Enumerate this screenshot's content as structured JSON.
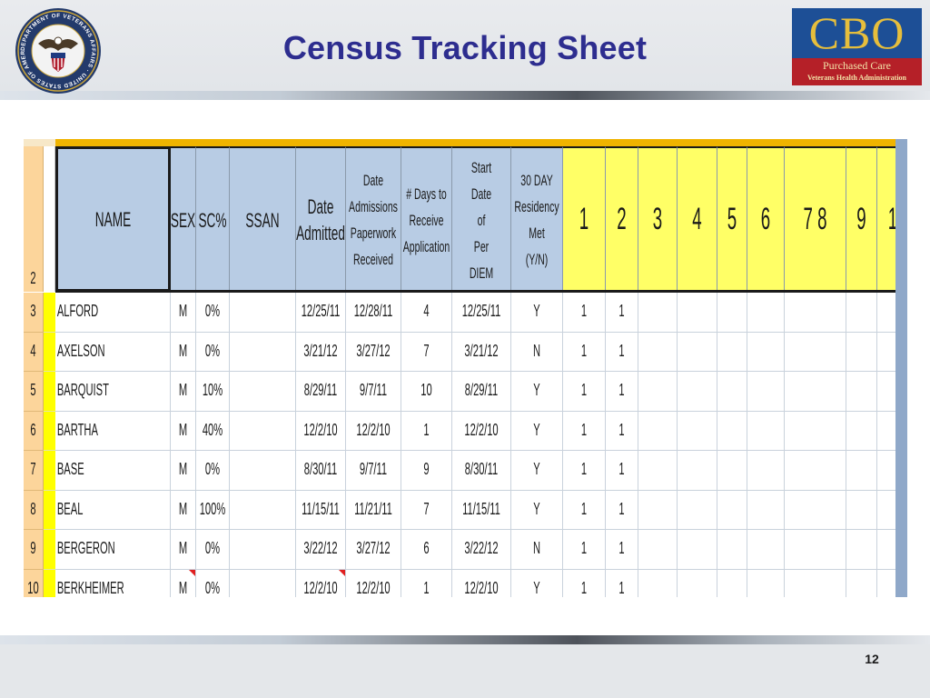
{
  "slide": {
    "title": "Census Tracking Sheet",
    "page_number": "12",
    "logo": {
      "main": "CBO",
      "line1": "Purchased Care",
      "line2": "Veterans Health Administration"
    },
    "seal_text": "DEPARTMENT OF VETERANS AFFAIRS · UNITED STATES OF AMERICA"
  },
  "sheet": {
    "header_row_number": "2",
    "columns": [
      {
        "id": "name",
        "label": "NAME"
      },
      {
        "id": "sex",
        "label": "SEX"
      },
      {
        "id": "sc",
        "label": "SC%"
      },
      {
        "id": "ssan",
        "label": "SSAN"
      },
      {
        "id": "date_admitted",
        "label": "Date\nAdmitted"
      },
      {
        "id": "date_paperwork",
        "label": "Date\nAdmissions\nPaperwork\nReceived"
      },
      {
        "id": "days",
        "label": "# Days to\nReceive\nApplication"
      },
      {
        "id": "start_date",
        "label": "Start Date\nof\nPer DIEM"
      },
      {
        "id": "residency",
        "label": "30 DAY\nResidency\nMet\n(Y/N)"
      },
      {
        "id": "n1",
        "label": "1"
      },
      {
        "id": "n2",
        "label": "2"
      },
      {
        "id": "n3",
        "label": "3"
      },
      {
        "id": "n4",
        "label": "4"
      },
      {
        "id": "n5",
        "label": "5"
      },
      {
        "id": "n6",
        "label": "6"
      },
      {
        "id": "n78",
        "label": "7      8"
      },
      {
        "id": "n9",
        "label": "9"
      },
      {
        "id": "n10",
        "label": "1"
      }
    ],
    "rows": [
      {
        "row": "3",
        "name": "ALFORD",
        "sex": "M",
        "sc": "0%",
        "ssan": "",
        "date_admitted": "12/25/11",
        "date_paperwork": "12/28/11",
        "days": "4",
        "start_date": "12/25/11",
        "residency": "Y",
        "n1": "1",
        "n2": "1"
      },
      {
        "row": "4",
        "name": "AXELSON",
        "sex": "M",
        "sc": "0%",
        "ssan": "",
        "date_admitted": "3/21/12",
        "date_paperwork": "3/27/12",
        "days": "7",
        "start_date": "3/21/12",
        "residency": "N",
        "n1": "1",
        "n2": "1"
      },
      {
        "row": "5",
        "name": "BARQUIST",
        "sex": "M",
        "sc": "10%",
        "ssan": "",
        "date_admitted": "8/29/11",
        "date_paperwork": "9/7/11",
        "days": "10",
        "start_date": "8/29/11",
        "residency": "Y",
        "n1": "1",
        "n2": "1"
      },
      {
        "row": "6",
        "name": "BARTHA",
        "sex": "M",
        "sc": "40%",
        "ssan": "",
        "date_admitted": "12/2/10",
        "date_paperwork": "12/2/10",
        "days": "1",
        "start_date": "12/2/10",
        "residency": "Y",
        "n1": "1",
        "n2": "1"
      },
      {
        "row": "7",
        "name": "BASE",
        "sex": "M",
        "sc": "0%",
        "ssan": "",
        "date_admitted": "8/30/11",
        "date_paperwork": "9/7/11",
        "days": "9",
        "start_date": "8/30/11",
        "residency": "Y",
        "n1": "1",
        "n2": "1"
      },
      {
        "row": "8",
        "name": "BEAL",
        "sex": "M",
        "sc": "100%",
        "ssan": "",
        "date_admitted": "11/15/11",
        "date_paperwork": "11/21/11",
        "days": "7",
        "start_date": "11/15/11",
        "residency": "Y",
        "n1": "1",
        "n2": "1"
      },
      {
        "row": "9",
        "name": "BERGERON",
        "sex": "M",
        "sc": "0%",
        "ssan": "",
        "date_admitted": "3/22/12",
        "date_paperwork": "3/27/12",
        "days": "6",
        "start_date": "3/22/12",
        "residency": "N",
        "n1": "1",
        "n2": "1"
      },
      {
        "row": "10",
        "name": "BERKHEIMER",
        "sex": "M",
        "sc": "0%",
        "ssan": "",
        "date_admitted": "12/2/10",
        "date_paperwork": "12/2/10",
        "days": "1",
        "start_date": "12/2/10",
        "residency": "Y",
        "n1": "1",
        "n2": "1"
      }
    ],
    "colors": {
      "header_blue": "#b8cce4",
      "header_yellow": "#ffff66",
      "row_header_orange": "#fcd59b",
      "accent_yellow": "#ffff00",
      "top_stripe": "#f0b400",
      "comment_marker": "#e02020"
    }
  }
}
